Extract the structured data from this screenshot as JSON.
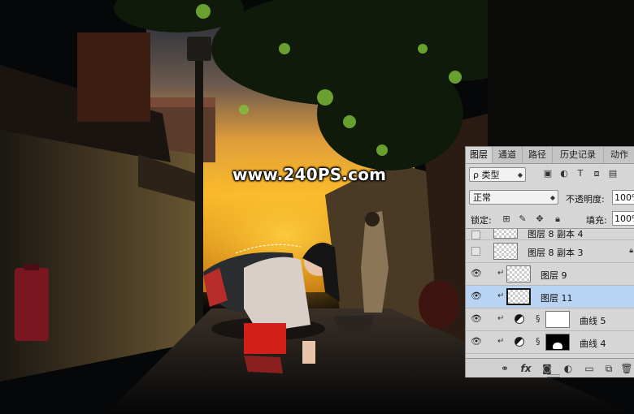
{
  "watermark": "www.240PS.com",
  "colors": {
    "panel_bg": "#d6d6d6",
    "selected_row": "#b9d3f3",
    "bag_red": "#d21f1a",
    "sky_orange": "#f2a21e"
  },
  "panel": {
    "tabs": [
      "图层",
      "通道",
      "路径",
      "历史记录",
      "动作"
    ],
    "active_tab": "图层",
    "filter": {
      "label": "ρ 类型",
      "icons": [
        "image-filter-icon",
        "adjustment-filter-icon",
        "type-filter-icon",
        "shape-filter-icon",
        "smart-object-filter-icon"
      ]
    },
    "blend_mode": "正常",
    "opacity_label": "不透明度:",
    "opacity_value": "100%",
    "lock_label": "锁定:",
    "fill_label": "填充:",
    "fill_value": "100%",
    "layers": [
      {
        "name": "图层 8 副本 4",
        "visible": false,
        "clipped": false,
        "thumb": "checker",
        "partial": true
      },
      {
        "name": "图层 8 副本 3",
        "visible": false,
        "clipped": false,
        "thumb": "checker",
        "locked": true
      },
      {
        "name": "图层 9",
        "visible": true,
        "clipped": true,
        "thumb": "checker"
      },
      {
        "name": "图层 11",
        "visible": true,
        "clipped": true,
        "thumb": "checker",
        "selected": true
      },
      {
        "name": "曲线 5",
        "visible": true,
        "clipped": true,
        "thumb": "white",
        "adjustment": true
      },
      {
        "name": "曲线 4",
        "visible": true,
        "clipped": true,
        "thumb": "mask",
        "adjustment": true
      }
    ],
    "bottom_icons": [
      "link-layers-icon",
      "fx-icon",
      "add-mask-icon",
      "new-adjustment-icon",
      "new-group-icon",
      "new-layer-icon",
      "delete-layer-icon"
    ]
  }
}
